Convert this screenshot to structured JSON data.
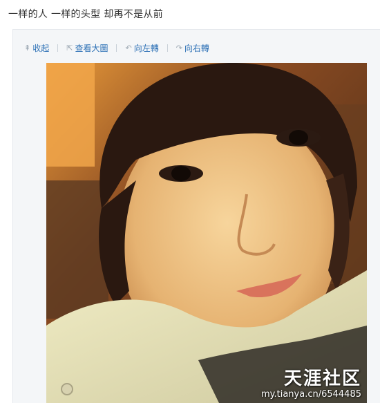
{
  "post": {
    "text": "一样的人 一样的头型 却再不是从前"
  },
  "toolbar": {
    "collapse": {
      "icon": "collapse-icon",
      "glyph": "⇞",
      "label": "收起"
    },
    "view_large": {
      "icon": "external-link-icon",
      "glyph": "⇱",
      "label": "查看大圖"
    },
    "rotate_left": {
      "icon": "rotate-left-icon",
      "glyph": "↶",
      "label": "向左轉"
    },
    "rotate_right": {
      "icon": "rotate-right-icon",
      "glyph": "↷",
      "label": "向右轉"
    }
  },
  "watermark": {
    "logo": "天涯社区",
    "url": "my.tianya.cn/6544485"
  }
}
